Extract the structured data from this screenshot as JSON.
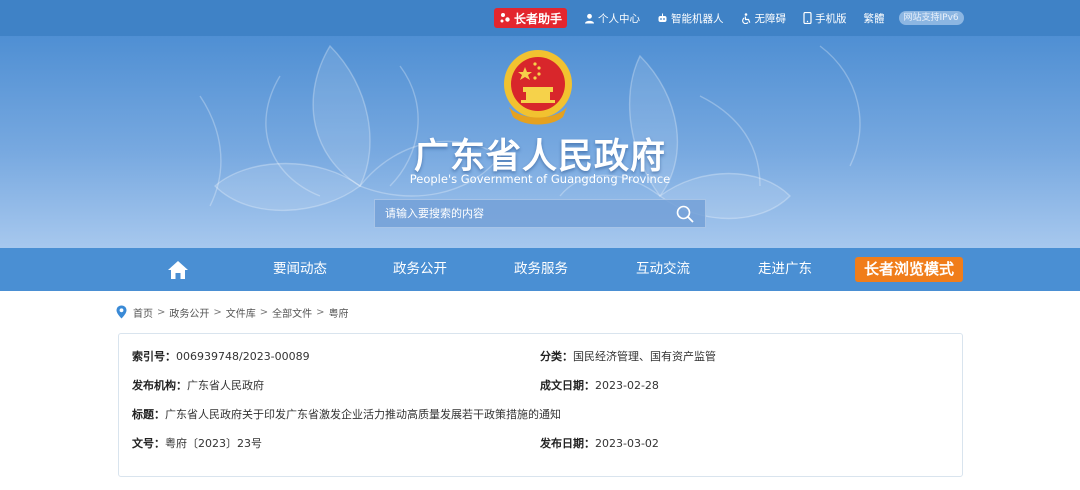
{
  "topbar": {
    "elder_assistant": "长者助手",
    "links": [
      "个人中心",
      "智能机器人",
      "无障碍",
      "手机版",
      "繁體"
    ],
    "ipv6_badge": "网站支持IPv6"
  },
  "banner": {
    "title": "广东省人民政府",
    "subtitle": "People's Government of Guangdong Province"
  },
  "search": {
    "placeholder": "请输入要搜索的内容"
  },
  "nav": {
    "items": [
      "要闻动态",
      "政务公开",
      "政务服务",
      "互动交流",
      "走进广东"
    ],
    "elder_mode": "长者浏览模式"
  },
  "breadcrumb": [
    "首页",
    "政务公开",
    "文件库",
    "全部文件",
    "粤府"
  ],
  "info": {
    "index_label": "索引号：",
    "index_value": "006939748/2023-00089",
    "category_label": "分类：",
    "category_value": "国民经济管理、国有资产监管",
    "publisher_label": "发布机构：",
    "publisher_value": "广东省人民政府",
    "written_date_label": "成文日期：",
    "written_date_value": "2023-02-28",
    "title_label": "标题：",
    "title_value": "广东省人民政府关于印发广东省激发企业活力推动高质量发展若干政策措施的通知",
    "doc_no_label": "文号：",
    "doc_no_value": "粤府〔2023〕23号",
    "publish_date_label": "发布日期：",
    "publish_date_value": "2023-03-02"
  },
  "colors": {
    "topbar": "#3f82c6",
    "nav": "#4a8fd3",
    "elder_red": "#e3262e",
    "elder_orange": "#f07d1a"
  },
  "icons": [
    "elder-assistant-icon",
    "user-icon",
    "robot-icon",
    "accessibility-icon",
    "mobile-icon",
    "search-icon",
    "home-icon",
    "location-pin-icon",
    "national-emblem"
  ]
}
